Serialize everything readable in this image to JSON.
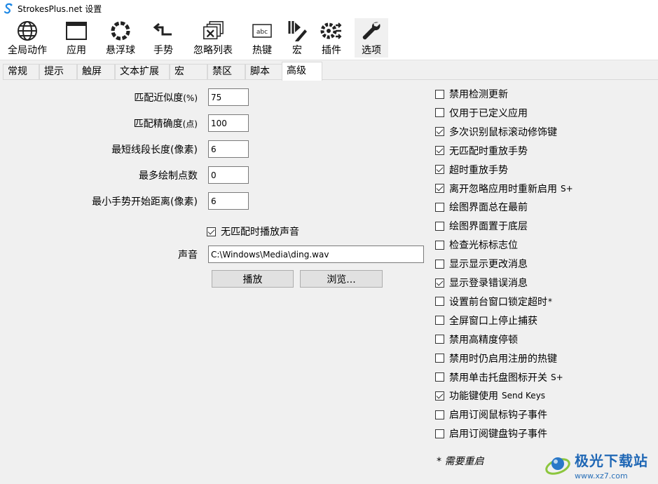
{
  "window": {
    "title": "StrokesPlus.net 设置"
  },
  "toolbar": [
    {
      "label": "全局动作",
      "icon": "globe-icon"
    },
    {
      "label": "应用",
      "icon": "window-icon"
    },
    {
      "label": "悬浮球",
      "icon": "ring-icon"
    },
    {
      "label": "手势",
      "icon": "gesture-arrow-icon"
    },
    {
      "label": "忽略列表",
      "icon": "ignore-windows-icon"
    },
    {
      "label": "热键",
      "icon": "keyboard-key-icon"
    },
    {
      "label": "宏",
      "icon": "macro-pen-icon"
    },
    {
      "label": "插件",
      "icon": "plugin-gear-icon"
    },
    {
      "label": "选项",
      "icon": "wrench-icon"
    }
  ],
  "tabs": [
    "常规",
    "提示",
    "触屏",
    "文本扩展",
    "宏",
    "禁区",
    "脚本",
    "高级"
  ],
  "active_tab": "高级",
  "fields": [
    {
      "label": "匹配近似度",
      "unit": "(%)",
      "value": "75"
    },
    {
      "label": "匹配精确度",
      "unit": "(点)",
      "value": "100"
    },
    {
      "label": "最短线段长度(像素)",
      "unit": "",
      "value": "6"
    },
    {
      "label": "最多绘制点数",
      "unit": "",
      "value": "0"
    },
    {
      "label": "最小手势开始距离(像素)",
      "unit": "",
      "value": "6"
    }
  ],
  "sound": {
    "checkbox_label": "无匹配时播放声音",
    "checked": true,
    "label": "声音",
    "path": "C:\\Windows\\Media\\ding.wav",
    "play_button": "播放",
    "browse_button": "浏览..."
  },
  "options": [
    {
      "label": "禁用检测更新",
      "suffix": "",
      "checked": false
    },
    {
      "label": "仅用于已定义应用",
      "suffix": "",
      "checked": false
    },
    {
      "label": "多次识别鼠标滚动修饰键",
      "suffix": "",
      "checked": true
    },
    {
      "label": "无匹配时重放手势",
      "suffix": "",
      "checked": true
    },
    {
      "label": "超时重放手势",
      "suffix": "",
      "checked": true
    },
    {
      "label": "离开忽略应用时重新启用",
      "suffix": "S+",
      "checked": true
    },
    {
      "label": "绘图界面总在最前",
      "suffix": "",
      "checked": false
    },
    {
      "label": "绘图界面置于底层",
      "suffix": "",
      "checked": false
    },
    {
      "label": "检查光标标志位",
      "suffix": "",
      "checked": false
    },
    {
      "label": "显示显示更改消息",
      "suffix": "",
      "checked": false
    },
    {
      "label": "显示登录错误消息",
      "suffix": "",
      "checked": true
    },
    {
      "label": "设置前台窗口锁定超时",
      "suffix": "*",
      "checked": false
    },
    {
      "label": "全屏窗口上停止捕获",
      "suffix": "",
      "checked": false
    },
    {
      "label": "禁用高精度停顿",
      "suffix": "",
      "checked": false
    },
    {
      "label": "禁用时仍启用注册的热键",
      "suffix": "",
      "checked": false
    },
    {
      "label": "禁用单击托盘图标开关",
      "suffix": "S+",
      "checked": false
    },
    {
      "label": "功能键使用",
      "suffix": "Send Keys",
      "checked": true
    },
    {
      "label": "启用订阅鼠标钩子事件",
      "suffix": "",
      "checked": false
    },
    {
      "label": "启用订阅键盘钩子事件",
      "suffix": "",
      "checked": false
    }
  ],
  "restart_note": "* 需要重启",
  "watermark": {
    "title": "极光下载站",
    "url": "www.xz7.com"
  },
  "colors": {
    "accent": "#1f67b5",
    "window_bg": "#f0f0f0"
  }
}
